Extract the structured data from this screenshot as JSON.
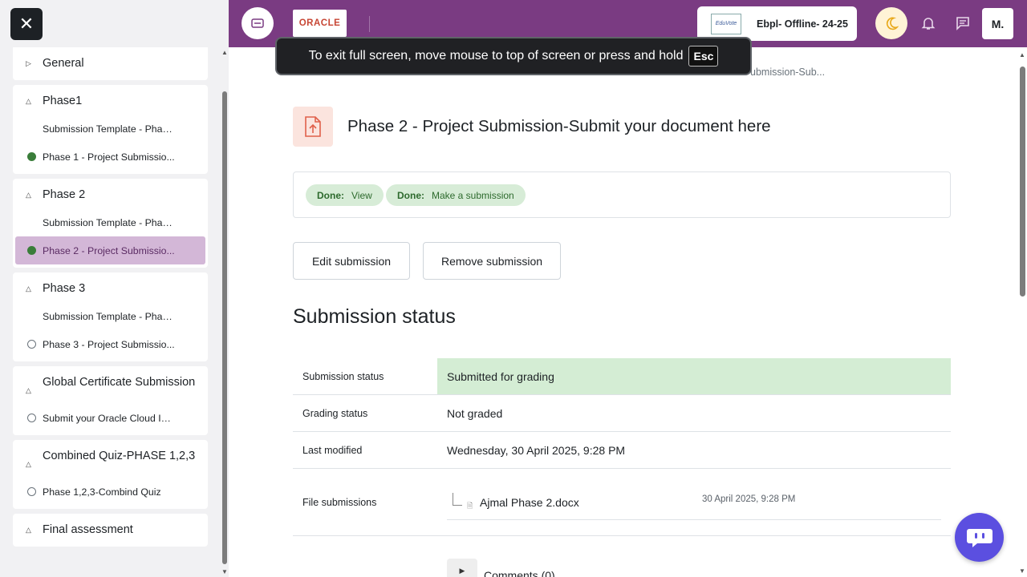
{
  "sidebar": {
    "close_icon": "close-icon",
    "sections": [
      {
        "title": "General",
        "expanded": false,
        "items": []
      },
      {
        "title": "Phase1",
        "expanded": true,
        "items": [
          {
            "label": "Submission Template - Phas...",
            "status": "none"
          },
          {
            "label": "Phase 1 - Project Submissio...",
            "status": "complete"
          }
        ]
      },
      {
        "title": "Phase 2",
        "expanded": true,
        "items": [
          {
            "label": "Submission Template - Phas...",
            "status": "none"
          },
          {
            "label": "Phase 2 - Project Submissio...",
            "status": "complete",
            "active": true
          }
        ]
      },
      {
        "title": "Phase 3",
        "expanded": true,
        "items": [
          {
            "label": "Submission Template - Phas...",
            "status": "none"
          },
          {
            "label": "Phase 3 - Project Submissio...",
            "status": "incomplete"
          }
        ]
      },
      {
        "title": "Global Certificate Submission",
        "expanded": true,
        "items": [
          {
            "label": "Submit your Oracle Cloud Inf...",
            "status": "incomplete"
          }
        ]
      },
      {
        "title": "Combined Quiz-PHASE 1,2,3",
        "expanded": true,
        "items": [
          {
            "label": "Phase 1,2,3-Combind Quiz",
            "status": "incomplete"
          }
        ]
      },
      {
        "title": "Final assessment",
        "expanded": true,
        "items": []
      }
    ]
  },
  "topbar": {
    "brand_logo_text": "ORACLE",
    "course_logo_text": "EduVote",
    "course_name": "Ebpl- Offline- 24-25",
    "avatar_initial": "M.",
    "accent_color": "#7a3b82"
  },
  "fullscreen_toast": {
    "message": "To exit full screen, move mouse to top of screen or press and hold",
    "key": "Esc"
  },
  "breadcrumb_tail": "ubmission-Sub...",
  "activity": {
    "title": "Phase 2 - Project Submission-Submit your document here",
    "completion": [
      {
        "state": "Done:",
        "label": "View"
      },
      {
        "state": "Done:",
        "label": "Make a submission"
      }
    ],
    "buttons": {
      "edit": "Edit submission",
      "remove": "Remove submission"
    }
  },
  "submission": {
    "heading": "Submission status",
    "rows": [
      {
        "label": "Submission status",
        "value": "Submitted for grading"
      },
      {
        "label": "Grading status",
        "value": "Not graded"
      },
      {
        "label": "Last modified",
        "value": "Wednesday, 30 April 2025, 9:28 PM"
      }
    ],
    "files_label": "File submissions",
    "file": {
      "name": "Ajmal Phase 2.docx",
      "date": "30 April 2025, 9:28 PM"
    },
    "comments": "Comments (0)"
  }
}
